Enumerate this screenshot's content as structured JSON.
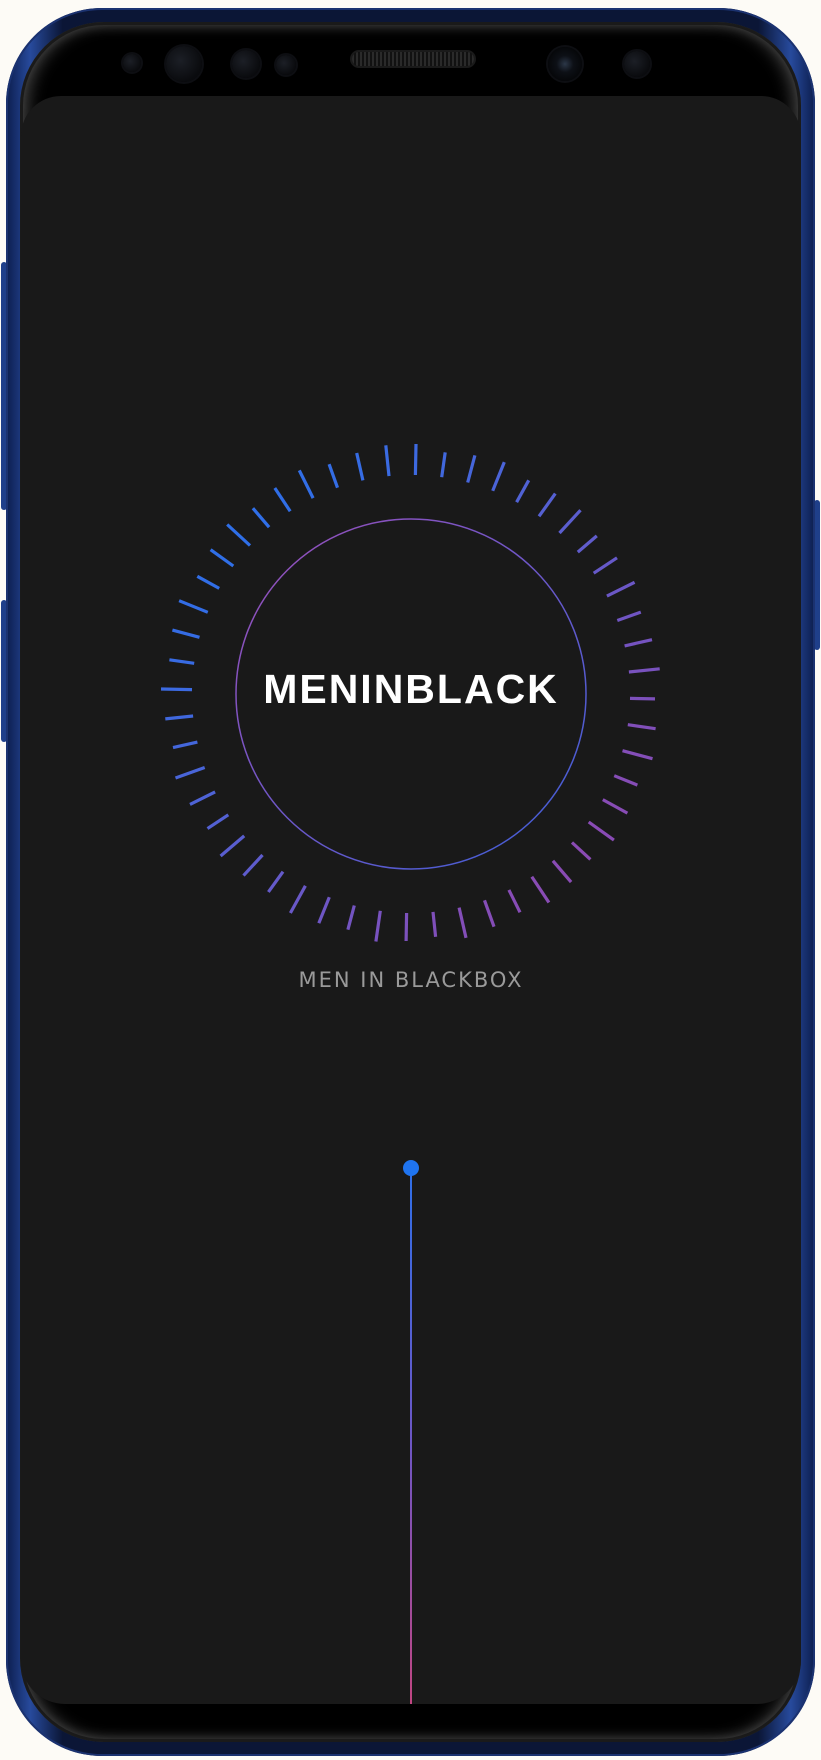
{
  "app": {
    "title": "MENINBLACK",
    "subtitle": "MEN IN BLACKBOX"
  },
  "theme": {
    "screen_background": "#191919",
    "title_color": "#ffffff",
    "subtitle_color": "#9a9a9a",
    "accent_blue": "#2f6fe8",
    "accent_purple": "#8a4bb4",
    "accent_pink": "#c4457f"
  },
  "icons": {
    "progress_ring": "tick-ring-icon",
    "slider_handle": "dot-handle-icon"
  }
}
